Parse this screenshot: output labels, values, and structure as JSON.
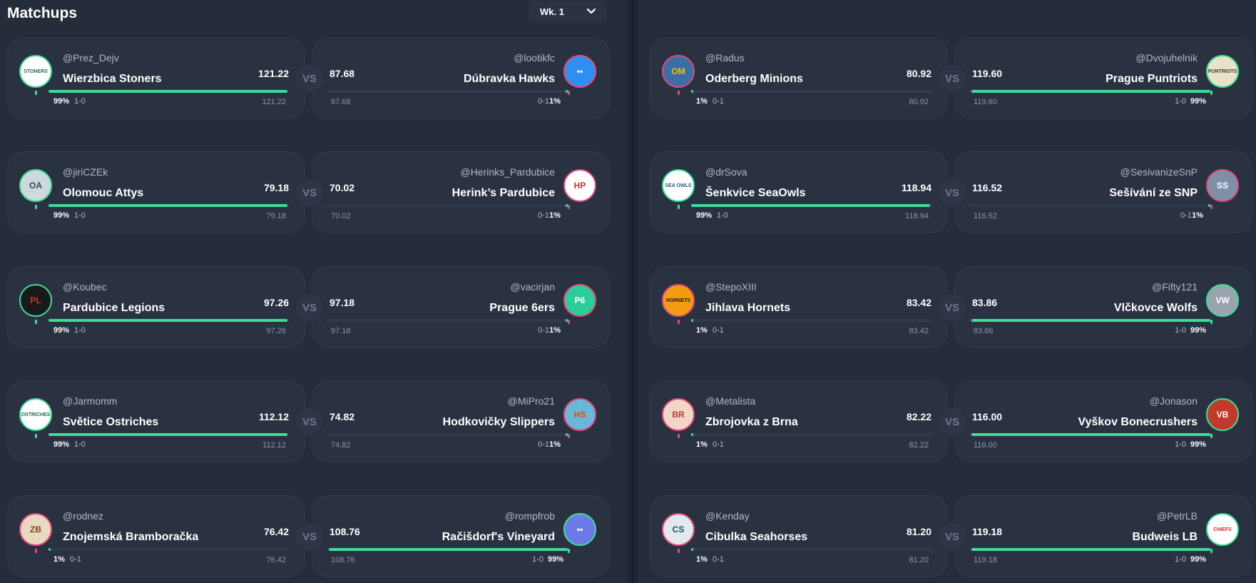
{
  "header": {
    "title": "Matchups",
    "week": "Wk. 1"
  },
  "vs_label": "VS",
  "matchups": [
    {
      "col": 0,
      "row": 0,
      "left": {
        "handle": "@Prez_Dejv",
        "team": "Wierzbica Stoners",
        "score": "121.22",
        "pct": "99%",
        "record": "1-0",
        "win": true,
        "logo_text": "STONERS",
        "logo_bg": "#ffffff",
        "logo_fg": "#2b6b4a",
        "ring": "#3ddc97"
      },
      "right": {
        "handle": "@lootikfc",
        "team": "Dúbravka Hawks",
        "score": "87.68",
        "pct": "1%",
        "record": "0-1",
        "win": false,
        "logo_text": "••",
        "logo_bg": "#2f8ef0",
        "logo_fg": "#ffffff",
        "ring": "#e04b7a"
      }
    },
    {
      "col": 0,
      "row": 1,
      "left": {
        "handle": "@jiriCZEk",
        "team": "Olomouc Attys",
        "score": "79.18",
        "pct": "99%",
        "record": "1-0",
        "win": true,
        "logo_text": "OA",
        "logo_bg": "#cfd8dc",
        "logo_fg": "#2e4a5a",
        "ring": "#3ddc97"
      },
      "right": {
        "handle": "@Herinks_Pardubice",
        "team": "Herink’s Pardubice",
        "score": "70.02",
        "pct": "1%",
        "record": "0-1",
        "win": false,
        "logo_text": "HP",
        "logo_bg": "#ffffff",
        "logo_fg": "#c0392b",
        "ring": "#e04b7a"
      }
    },
    {
      "col": 0,
      "row": 2,
      "left": {
        "handle": "@Koubec",
        "team": "Pardubice Legions",
        "score": "97.26",
        "pct": "99%",
        "record": "1-0",
        "win": true,
        "logo_text": "PL",
        "logo_bg": "#1a1a1a",
        "logo_fg": "#c0392b",
        "ring": "#3ddc97"
      },
      "right": {
        "handle": "@vacirjan",
        "team": "Prague 6ers",
        "score": "97.18",
        "pct": "1%",
        "record": "0-1",
        "win": false,
        "logo_text": "P6",
        "logo_bg": "#2ecc9a",
        "logo_fg": "#ffffff",
        "ring": "#e04b7a"
      }
    },
    {
      "col": 0,
      "row": 3,
      "left": {
        "handle": "@Jarmomm",
        "team": "Světice Ostriches",
        "score": "112.12",
        "pct": "99%",
        "record": "1-0",
        "win": true,
        "logo_text": "OSTRICHES",
        "logo_bg": "#ffffff",
        "logo_fg": "#1e6b4f",
        "ring": "#3ddc97"
      },
      "right": {
        "handle": "@MiPro21",
        "team": "Hodkovičky Slippers",
        "score": "74.82",
        "pct": "1%",
        "record": "0-1",
        "win": false,
        "logo_text": "HS",
        "logo_bg": "#6ab7d9",
        "logo_fg": "#d35400",
        "ring": "#e04b7a"
      }
    },
    {
      "col": 0,
      "row": 4,
      "left": {
        "handle": "@rodnez",
        "team": "Znojemská Bramboračka",
        "score": "76.42",
        "pct": "1%",
        "record": "0-1",
        "win": false,
        "logo_text": "ZB",
        "logo_bg": "#e9d8c2",
        "logo_fg": "#7a4b1e",
        "ring": "#e04b7a"
      },
      "right": {
        "handle": "@rompfrob",
        "team": "Račišdorf's Vineyard",
        "score": "108.76",
        "pct": "99%",
        "record": "1-0",
        "win": true,
        "logo_text": "••",
        "logo_bg": "#6c7be8",
        "logo_fg": "#ffffff",
        "ring": "#3ddc97"
      }
    },
    {
      "col": 1,
      "row": 0,
      "left": {
        "handle": "@Radus",
        "team": "Oderberg Minions",
        "score": "80.92",
        "pct": "1%",
        "record": "0-1",
        "win": false,
        "logo_text": "OM",
        "logo_bg": "#3a6ea5",
        "logo_fg": "#f1c40f",
        "ring": "#e04b7a"
      },
      "right": {
        "handle": "@Dvojuhelnik",
        "team": "Prague Puntriots",
        "score": "119.60",
        "pct": "99%",
        "record": "1-0",
        "win": true,
        "logo_text": "PUNTRIOTS",
        "logo_bg": "#e8e2c8",
        "logo_fg": "#3b3b3b",
        "ring": "#3ddc97"
      }
    },
    {
      "col": 1,
      "row": 1,
      "left": {
        "handle": "@drSova",
        "team": "Šenkvice SeaOwls",
        "score": "118.94",
        "pct": "99%",
        "record": "1-0",
        "win": true,
        "logo_text": "SEA OWLS",
        "logo_bg": "#ffffff",
        "logo_fg": "#1e5b7a",
        "ring": "#3ddc97"
      },
      "right": {
        "handle": "@SesivanizeSnP",
        "team": "Sešívání ze SNP",
        "score": "116.52",
        "pct": "1%",
        "record": "0-1",
        "win": false,
        "logo_text": "SS",
        "logo_bg": "#7f8fa6",
        "logo_fg": "#ffffff",
        "ring": "#e04b7a"
      }
    },
    {
      "col": 1,
      "row": 2,
      "left": {
        "handle": "@StepoXIII",
        "team": "Jihlava Hornets",
        "score": "83.42",
        "pct": "1%",
        "record": "0-1",
        "win": false,
        "logo_text": "HORNETS",
        "logo_bg": "#f39c12",
        "logo_fg": "#1a1a1a",
        "ring": "#e04b7a"
      },
      "right": {
        "handle": "@Fifty121",
        "team": "Vlčkovce Wolfs",
        "score": "83.86",
        "pct": "99%",
        "record": "1-0",
        "win": true,
        "logo_text": "VW",
        "logo_bg": "#9aa4ae",
        "logo_fg": "#ffffff",
        "ring": "#3ddc97"
      }
    },
    {
      "col": 1,
      "row": 3,
      "left": {
        "handle": "@Metalista",
        "team": "Zbrojovka z Brna",
        "score": "82.22",
        "pct": "1%",
        "record": "0-1",
        "win": false,
        "logo_text": "BR",
        "logo_bg": "#f2d7c9",
        "logo_fg": "#c0392b",
        "ring": "#e04b7a"
      },
      "right": {
        "handle": "@Jonason",
        "team": "Vyškov Bonecrushers",
        "score": "116.00",
        "pct": "99%",
        "record": "1-0",
        "win": true,
        "logo_text": "VB",
        "logo_bg": "#c0392b",
        "logo_fg": "#ffffff",
        "ring": "#3ddc97"
      }
    },
    {
      "col": 1,
      "row": 4,
      "left": {
        "handle": "@Kenday",
        "team": "Cibulka Seahorses",
        "score": "81.20",
        "pct": "1%",
        "record": "0-1",
        "win": false,
        "logo_text": "CS",
        "logo_bg": "#dfe9ee",
        "logo_fg": "#1f4e5f",
        "ring": "#e04b7a"
      },
      "right": {
        "handle": "@PetrLB",
        "team": "Budweis LB",
        "score": "119.18",
        "pct": "99%",
        "record": "1-0",
        "win": true,
        "logo_text": "CHIEFS",
        "logo_bg": "#ffffff",
        "logo_fg": "#e31837",
        "ring": "#3ddc97"
      }
    }
  ]
}
